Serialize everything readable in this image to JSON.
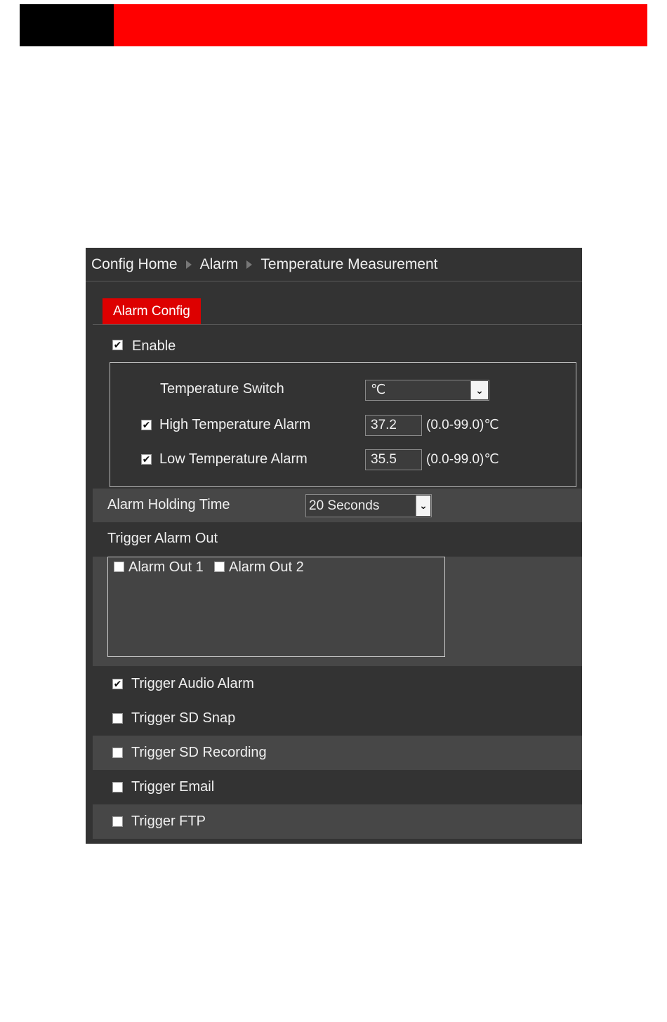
{
  "colors": {
    "accent": "#ff0000",
    "panel_bg": "#333333",
    "tab_active": "#dd0000"
  },
  "breadcrumb": {
    "home": "Config Home",
    "section": "Alarm",
    "page": "Temperature Measurement"
  },
  "tabs": [
    {
      "label": "Alarm Config",
      "active": true
    }
  ],
  "enable": {
    "label": "Enable",
    "checked": true
  },
  "temperature": {
    "switch_label": "Temperature Switch",
    "switch_value": "℃",
    "high": {
      "label": "High Temperature Alarm",
      "checked": true,
      "value": "37.2",
      "range": "(0.0-99.0)℃"
    },
    "low": {
      "label": "Low Temperature Alarm",
      "checked": true,
      "value": "35.5",
      "range": "(0.0-99.0)℃"
    }
  },
  "holding": {
    "label": "Alarm Holding Time",
    "value": "20 Seconds"
  },
  "trigger_out": {
    "label": "Trigger Alarm Out",
    "options": [
      {
        "label": "Alarm Out 1",
        "checked": false
      },
      {
        "label": "Alarm Out 2",
        "checked": false
      }
    ]
  },
  "triggers": [
    {
      "label": "Trigger Audio Alarm",
      "checked": true
    },
    {
      "label": "Trigger SD Snap",
      "checked": false
    },
    {
      "label": "Trigger SD Recording",
      "checked": false
    },
    {
      "label": "Trigger Email",
      "checked": false
    },
    {
      "label": "Trigger FTP",
      "checked": false
    }
  ]
}
